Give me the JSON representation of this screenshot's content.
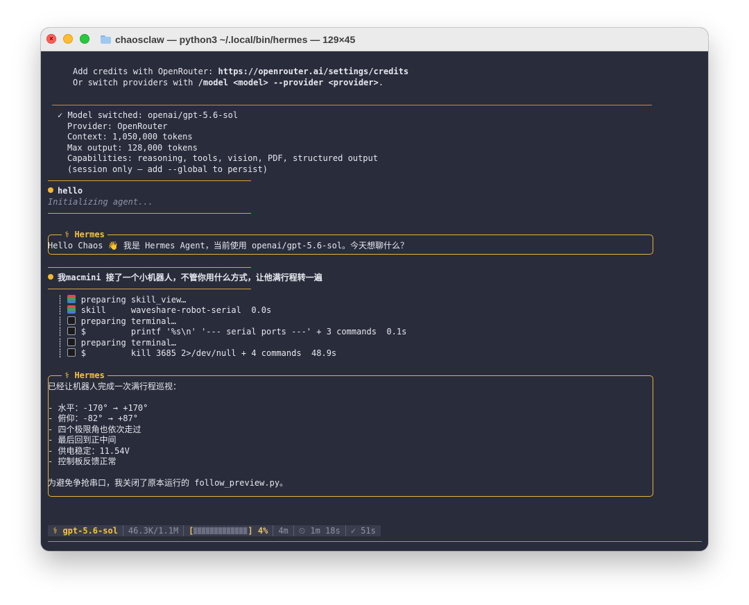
{
  "window": {
    "title": "chaosclaw — python3 ~/.local/bin/hermes — 129×45"
  },
  "credits": {
    "line1_prefix": "Add credits with OpenRouter: ",
    "line1_url": "https://openrouter.ai/settings/credits",
    "line2_prefix": "Or switch providers with ",
    "line2_cmd": "/model <model> --provider <provider>",
    "line2_suffix": "."
  },
  "model_switch": {
    "line1": "✓ Model switched: openai/gpt-5.6-sol",
    "line2": "Provider: OpenRouter",
    "line3": "Context: 1,050,000 tokens",
    "line4": "Max output: 128,000 tokens",
    "line5": "Capabilities: reasoning, tools, vision, PDF, structured output",
    "line6": "(session only — add --global to persist)"
  },
  "user_msg_1": {
    "text": "hello",
    "status": "Initializing agent..."
  },
  "hermes_1": {
    "label": "⚕ Hermes",
    "text": "Hello Chaos 👋 我是 Hermes Agent，当前使用 openai/gpt-5.6-sol。今天想聊什么？"
  },
  "user_msg_2": {
    "text": "我macmini 接了一个小机器人，不管你用什么方式，让他满行程转一遍"
  },
  "tools": [
    {
      "text": "preparing skill_view…",
      "icon": "books-icon"
    },
    {
      "text": "skill     waveshare-robot-serial  0.0s",
      "icon": "books-icon"
    },
    {
      "text": "preparing terminal…",
      "icon": "terminal-icon"
    },
    {
      "text": "$         printf '%s\\n' '--- serial ports ---' + 3 commands  0.1s",
      "icon": "terminal-icon"
    },
    {
      "text": "preparing terminal…",
      "icon": "terminal-icon"
    },
    {
      "text": "$         kill 3685 2>/dev/null + 4 commands  48.9s",
      "icon": "terminal-icon"
    }
  ],
  "hermes_2": {
    "label": "⚕ Hermes",
    "lines": [
      "已经让机器人完成一次满行程巡视：",
      "",
      "- 水平：-170° → +170°",
      "- 俯仰：-82° → +87°",
      "- 四个极限角也依次走过",
      "- 最后回到正中间",
      "- 供电稳定：11.54V",
      "- 控制板反馈正常",
      "",
      "为避免争抢串口，我关闭了原本运行的 follow_preview.py。"
    ]
  },
  "status_bar": {
    "model": "⚕ gpt-5.6-sol",
    "tokens": "46.3K/1.1M",
    "bar_open": "[",
    "bar_close": "]",
    "percent": "4%",
    "context_fill": 0.04,
    "duration": "4m",
    "timer": "⏲ 1m 18s",
    "check": "✓ 51s"
  },
  "prompt": {
    "symbol": "❯"
  },
  "colors": {
    "terminal_bg": "#292c3b",
    "accent_gold": "#f5c33b",
    "divider": "#c8873f"
  }
}
